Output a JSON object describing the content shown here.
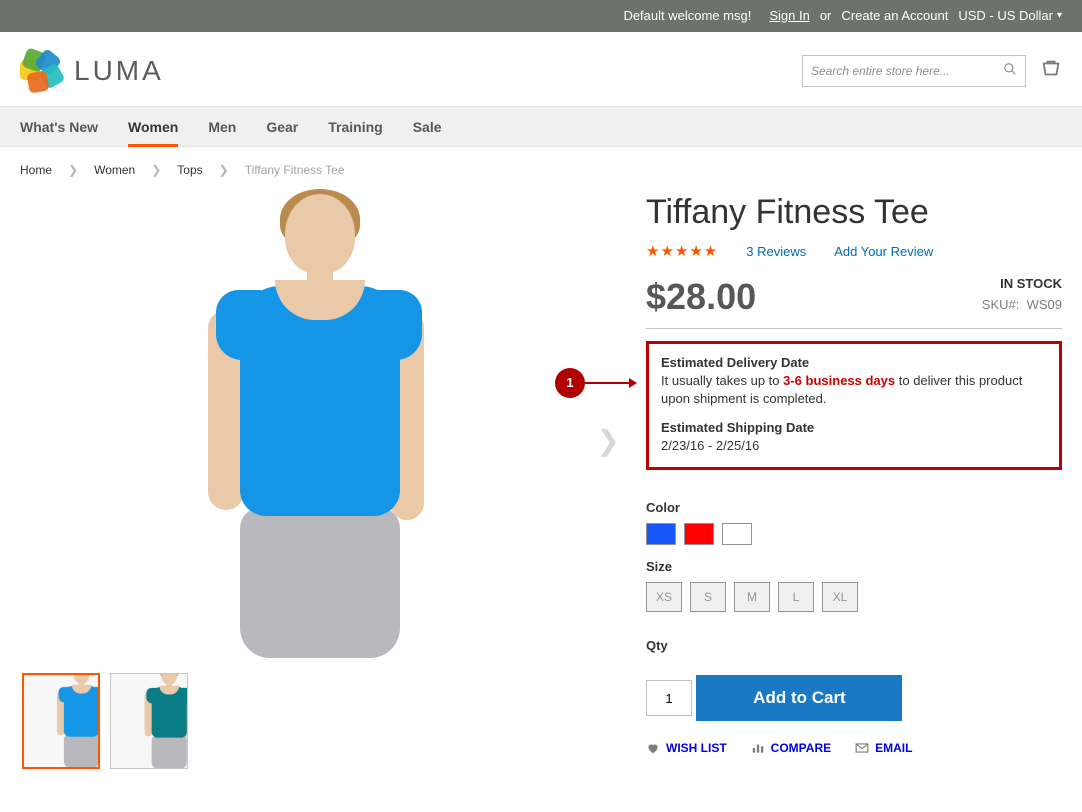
{
  "panel": {
    "welcome": "Default welcome msg!",
    "signin": "Sign In",
    "or": "or",
    "create": "Create an Account",
    "currency": "USD - US Dollar"
  },
  "logo": {
    "text": "LUMA"
  },
  "search": {
    "placeholder": "Search entire store here..."
  },
  "nav": {
    "items": [
      "What's New",
      "Women",
      "Men",
      "Gear",
      "Training",
      "Sale"
    ],
    "active_index": 1
  },
  "breadcrumbs": {
    "items": [
      "Home",
      "Women",
      "Tops"
    ],
    "current": "Tiffany Fitness Tee"
  },
  "product": {
    "title": "Tiffany Fitness Tee",
    "stars": "★★★★★",
    "reviews_link": "3 Reviews",
    "add_review": "Add Your Review",
    "price": "$28.00",
    "stock": "IN STOCK",
    "sku_label": "SKU#:",
    "sku": "WS09"
  },
  "annotation": {
    "number": "1"
  },
  "estimate": {
    "delivery_title": "Estimated Delivery Date",
    "delivery_text_a": "It usually takes up to ",
    "delivery_highlight": "3-6 business days",
    "delivery_text_b": " to deliver this product upon shipment is completed.",
    "shipping_title": "Estimated Shipping Date",
    "shipping_range": "2/23/16 - 2/25/16"
  },
  "labels": {
    "color": "Color",
    "size": "Size",
    "qty": "Qty"
  },
  "sizes": [
    "XS",
    "S",
    "M",
    "L",
    "XL"
  ],
  "qty_value": "1",
  "addcart": "Add to Cart",
  "actions": {
    "wishlist": "WISH LIST",
    "compare": "COMPARE",
    "email": "EMAIL"
  }
}
